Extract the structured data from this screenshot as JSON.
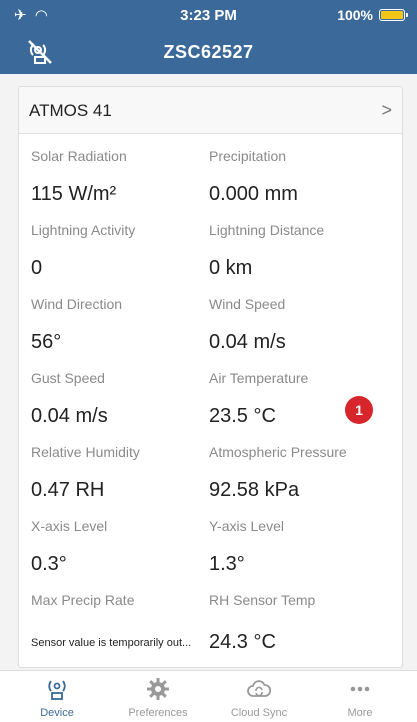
{
  "status_bar": {
    "time": "3:23 PM",
    "battery": "100%"
  },
  "nav": {
    "title": "ZSC62527"
  },
  "device": {
    "name": "ATMOS 41"
  },
  "readings": [
    {
      "label": "Solar Radiation",
      "value": "115 W/m²"
    },
    {
      "label": "Precipitation",
      "value": "0.000 mm"
    },
    {
      "label": "Lightning Activity",
      "value": "0"
    },
    {
      "label": "Lightning Distance",
      "value": "0 km"
    },
    {
      "label": "Wind Direction",
      "value": "56°"
    },
    {
      "label": "Wind Speed",
      "value": "0.04 m/s"
    },
    {
      "label": "Gust Speed",
      "value": "0.04 m/s"
    },
    {
      "label": "Air Temperature",
      "value": "23.5 °C"
    },
    {
      "label": "Relative Humidity",
      "value": "0.47 RH"
    },
    {
      "label": "Atmospheric Pressure",
      "value": "92.58 kPa"
    },
    {
      "label": "X-axis Level",
      "value": "0.3°"
    },
    {
      "label": "Y-axis Level",
      "value": "1.3°"
    },
    {
      "label": "Max Precip Rate",
      "value": "Sensor value is temporarily out..."
    },
    {
      "label": "RH Sensor Temp",
      "value": "24.3 °C"
    }
  ],
  "badge": {
    "count": "1"
  },
  "tabs": [
    {
      "label": "Device",
      "icon": "device-icon",
      "active": true
    },
    {
      "label": "Preferences",
      "icon": "gear-icon",
      "active": false
    },
    {
      "label": "Cloud Sync",
      "icon": "cloud-sync-icon",
      "active": false
    },
    {
      "label": "More",
      "icon": "more-icon",
      "active": false
    }
  ],
  "colors": {
    "accent": "#3b6a9a",
    "badge": "#d7262b",
    "battery": "#f5c518"
  }
}
